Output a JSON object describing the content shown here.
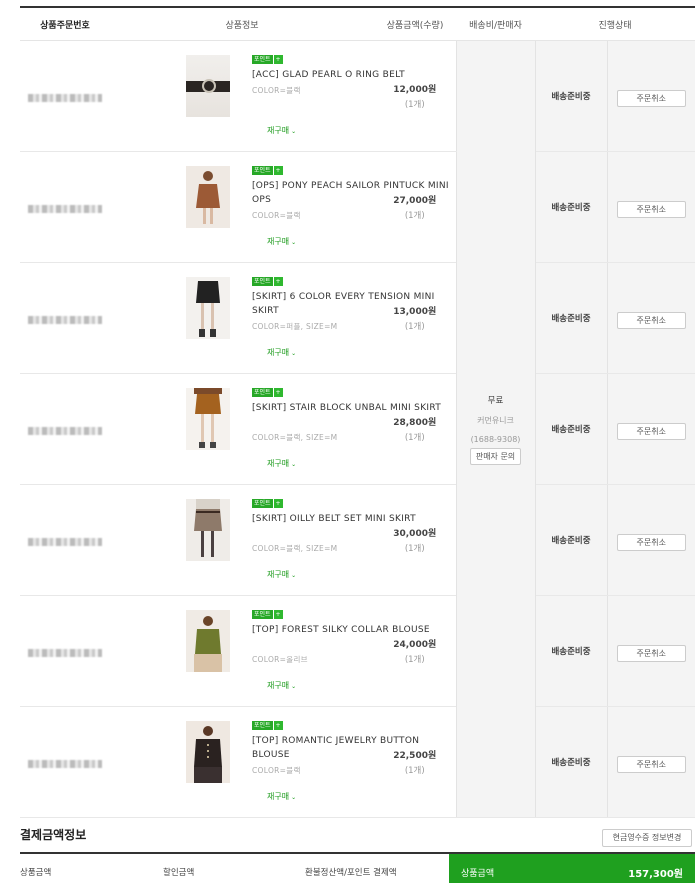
{
  "table": {
    "headers": {
      "order_no": "상품주문번호",
      "product_info": "상품정보",
      "amount": "상품금액(수량)",
      "shipping": "배송비/판매자",
      "status": "진행상태"
    }
  },
  "shipping": {
    "fee": "무료",
    "seller": "커먼유니크",
    "phone": "(1688-9308)",
    "inquiry_label": "판매자 문의"
  },
  "colors": {
    "accent_green": "#1fa01f",
    "badge_green": "#27a827"
  },
  "items": [
    {
      "badge": "포인트",
      "name": "[ACC] GLAD PEARL O RING BELT",
      "option": "COLOR=블랙",
      "reorder": "재구매",
      "price": "12,000원",
      "qty": "(1개)",
      "status": "배송준비중",
      "cancel": "주문취소"
    },
    {
      "badge": "포인트",
      "name": "[OPS] PONY PEACH SAILOR PINTUCK MINI OPS",
      "option": "COLOR=블랙",
      "reorder": "재구매",
      "price": "27,000원",
      "qty": "(1개)",
      "status": "배송준비중",
      "cancel": "주문취소"
    },
    {
      "badge": "포인트",
      "name": "[SKIRT] 6 COLOR EVERY TENSION MINI SKIRT",
      "option": "COLOR=퍼플, SIZE=M",
      "reorder": "재구매",
      "price": "13,000원",
      "qty": "(1개)",
      "status": "배송준비중",
      "cancel": "주문취소"
    },
    {
      "badge": "포인트",
      "name": "[SKIRT] STAIR BLOCK UNBAL MINI SKIRT",
      "option": "COLOR=블랙, SIZE=M",
      "reorder": "재구매",
      "price": "28,800원",
      "qty": "(1개)",
      "status": "배송준비중",
      "cancel": "주문취소"
    },
    {
      "badge": "포인트",
      "name": "[SKIRT] OILLY BELT SET MINI SKIRT",
      "option": "COLOR=블랙, SIZE=M",
      "reorder": "재구매",
      "price": "30,000원",
      "qty": "(1개)",
      "status": "배송준비중",
      "cancel": "주문취소"
    },
    {
      "badge": "포인트",
      "name": "[TOP] FOREST SILKY COLLAR BLOUSE",
      "option": "COLOR=올리브",
      "reorder": "재구매",
      "price": "24,000원",
      "qty": "(1개)",
      "status": "배송준비중",
      "cancel": "주문취소"
    },
    {
      "badge": "포인트",
      "name": "[TOP] ROMANTIC JEWELRY BUTTON BLOUSE",
      "option": "COLOR=블랙",
      "reorder": "재구매",
      "price": "22,500원",
      "qty": "(1개)",
      "status": "배송준비중",
      "cancel": "주문취소"
    }
  ],
  "payment": {
    "title": "결제금액정보",
    "receipt_button": "현금영수증 정보변경",
    "labels": [
      "상품금액",
      "할인금액",
      "환불정산액/포인트 결제액"
    ],
    "total_label": "상품금액",
    "total_amount": "157,300원"
  }
}
